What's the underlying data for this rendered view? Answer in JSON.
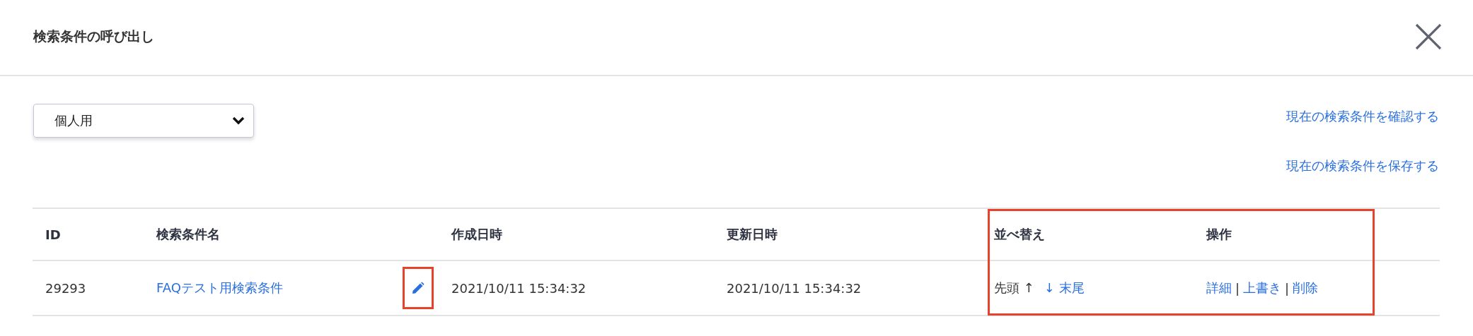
{
  "dialog": {
    "title": "検索条件の呼び出し"
  },
  "scope_select": {
    "value": "個人用"
  },
  "links": [
    "現在の検索条件を確認する",
    "現在の検索条件を保存する"
  ],
  "table": {
    "columns": [
      {
        "label": "ID"
      },
      {
        "label": "検索条件名"
      },
      {
        "label": "作成日時"
      },
      {
        "label": "更新日時"
      },
      {
        "label": "並べ替え"
      },
      {
        "label": "操作"
      }
    ],
    "sort_and_actions_highlighted": true,
    "rows": [
      {
        "id": "29293",
        "name": "FAQテスト用検索条件",
        "edit_highlighted": true,
        "created": "2021/10/11 15:34:32",
        "updated": "2021/10/11 15:34:32",
        "sort": [
          {
            "label": "先頭 ↑",
            "enabled": false
          },
          {
            "label": "↓ 末尾",
            "enabled": true
          }
        ],
        "actions": [
          "詳細",
          "上書き",
          "削除"
        ],
        "separator": "|"
      }
    ]
  }
}
